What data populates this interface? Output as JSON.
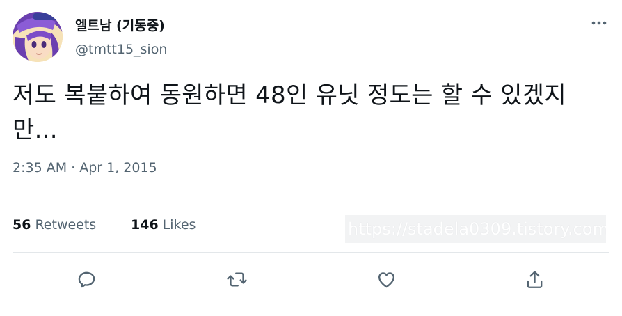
{
  "author": {
    "display_name": "엘트남 (기동중)",
    "handle": "@tmtt15_sion",
    "avatar_icon": "anime-avatar-icon"
  },
  "tweet": {
    "text": "저도 복붙하여 동원하면 48인 유닛 정도는 할 수 있겠지만...",
    "timestamp": "2:35 AM · Apr 1, 2015"
  },
  "stats": {
    "retweets_count": "56",
    "retweets_label": "Retweets",
    "likes_count": "146",
    "likes_label": "Likes"
  },
  "watermark": "https://stadela0309.tistory.com",
  "actions": {
    "reply": "reply-icon",
    "retweet": "retweet-icon",
    "like": "heart-icon",
    "share": "share-icon"
  },
  "colors": {
    "text_primary": "#0f1419",
    "text_secondary": "#536471",
    "icon": "#536471",
    "divider": "#e3e7ea"
  }
}
